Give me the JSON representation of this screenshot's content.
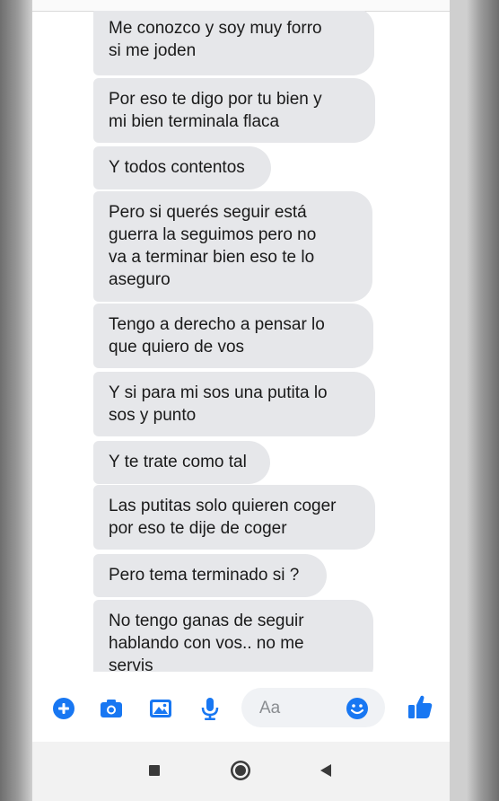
{
  "messages": [
    "Me conozco y soy muy forro\nsi me joden",
    "Por eso te digo por tu bien y\nmi bien terminala flaca",
    "Y todos contentos",
    "Pero si querés seguir está\nguerra la seguimos pero no\nva a terminar bien eso te lo\naseguro",
    "Tengo a derecho a pensar lo\nque quiero de vos",
    "Y si para mi sos una putita lo\nsos y punto",
    "Y te trate como tal",
    "Las putitas solo quieren coger\npor eso te dije de coger",
    "Pero tema terminado si ?",
    "No tengo ganas de seguir\nhablando con vos.. no me\nservis"
  ],
  "composer": {
    "placeholder": "Aa",
    "icons": [
      "plus-icon",
      "camera-icon",
      "image-icon",
      "microphone-icon",
      "emoji-icon",
      "thumbs-up-icon"
    ],
    "accent_color": "#1877f2"
  },
  "navbar": {
    "icons": [
      "recent-apps-icon",
      "home-icon",
      "back-icon"
    ]
  }
}
